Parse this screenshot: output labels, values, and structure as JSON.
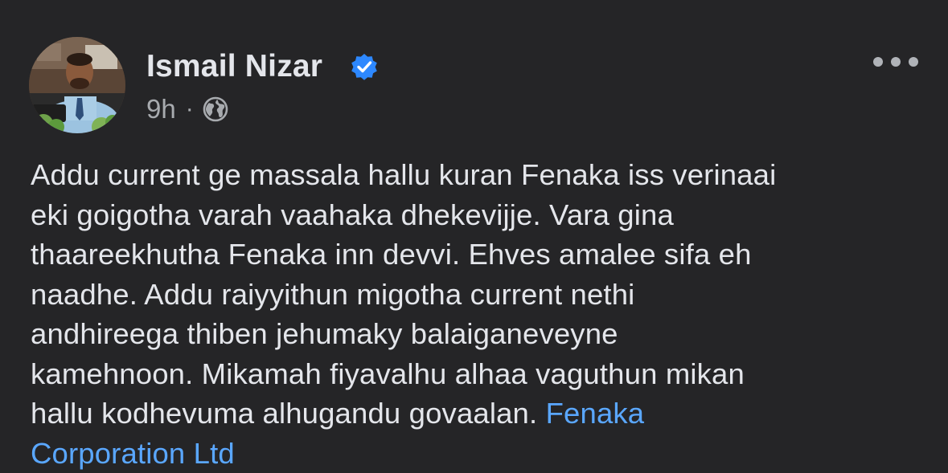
{
  "post": {
    "author": {
      "name": "Ismail Nizar",
      "verified": true,
      "verified_icon": "verified-badge-icon",
      "avatar_icon": "profile-photo"
    },
    "meta": {
      "time": "9h",
      "separator": "·",
      "audience_icon": "globe-icon"
    },
    "more_icon": "more-options-icon",
    "body_lines": [
      "Addu current ge massala hallu kuran Fenaka iss verinaai",
      "eki goigotha varah vaahaka dhekevijje. Vara gina",
      "thaareekhutha Fenaka inn devvi. Ehves amalee sifa eh",
      "naadhe. Addu raiyyithun migotha current nethi",
      "andhireega thiben jehumaky balaiganeveyne",
      "kamehnoon. Mikamah fiyavalhu alhaa vaguthun mikan",
      "hallu kodhevuma alhugandu govaalan."
    ],
    "mention_part1": "Fenaka",
    "mention_part2": "Corporation Ltd",
    "colors": {
      "background": "#252527",
      "text": "#e4e6eb",
      "secondary_text": "#a8abaf",
      "link": "#5aa7ff",
      "verified": "#2d88ff"
    }
  }
}
